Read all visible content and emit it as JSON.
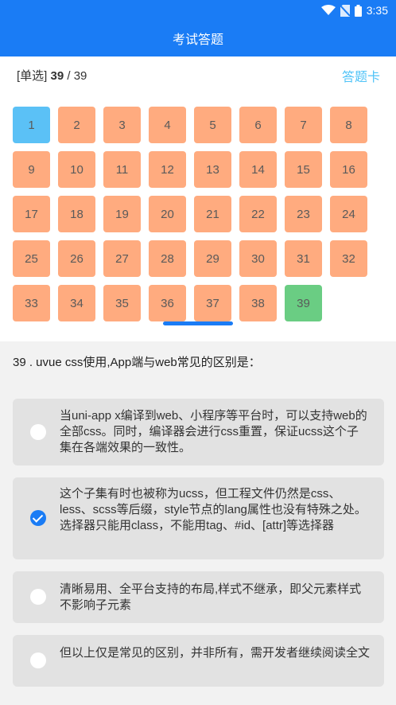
{
  "status_bar": {
    "time": "3:35"
  },
  "header": {
    "title": "考试答题"
  },
  "question_info": {
    "type": "[单选]",
    "current": "39",
    "separator": "/",
    "total": "39"
  },
  "answer_card_link": "答题卡",
  "grid": [
    {
      "num": "1",
      "state": "current"
    },
    {
      "num": "2",
      "state": "unanswered"
    },
    {
      "num": "3",
      "state": "unanswered"
    },
    {
      "num": "4",
      "state": "unanswered"
    },
    {
      "num": "5",
      "state": "unanswered"
    },
    {
      "num": "6",
      "state": "unanswered"
    },
    {
      "num": "7",
      "state": "unanswered"
    },
    {
      "num": "8",
      "state": "unanswered"
    },
    {
      "num": "9",
      "state": "unanswered"
    },
    {
      "num": "10",
      "state": "unanswered"
    },
    {
      "num": "11",
      "state": "unanswered"
    },
    {
      "num": "12",
      "state": "unanswered"
    },
    {
      "num": "13",
      "state": "unanswered"
    },
    {
      "num": "14",
      "state": "unanswered"
    },
    {
      "num": "15",
      "state": "unanswered"
    },
    {
      "num": "16",
      "state": "unanswered"
    },
    {
      "num": "17",
      "state": "unanswered"
    },
    {
      "num": "18",
      "state": "unanswered"
    },
    {
      "num": "19",
      "state": "unanswered"
    },
    {
      "num": "20",
      "state": "unanswered"
    },
    {
      "num": "21",
      "state": "unanswered"
    },
    {
      "num": "22",
      "state": "unanswered"
    },
    {
      "num": "23",
      "state": "unanswered"
    },
    {
      "num": "24",
      "state": "unanswered"
    },
    {
      "num": "25",
      "state": "unanswered"
    },
    {
      "num": "26",
      "state": "unanswered"
    },
    {
      "num": "27",
      "state": "unanswered"
    },
    {
      "num": "28",
      "state": "unanswered"
    },
    {
      "num": "29",
      "state": "unanswered"
    },
    {
      "num": "30",
      "state": "unanswered"
    },
    {
      "num": "31",
      "state": "unanswered"
    },
    {
      "num": "32",
      "state": "unanswered"
    },
    {
      "num": "33",
      "state": "unanswered"
    },
    {
      "num": "34",
      "state": "unanswered"
    },
    {
      "num": "35",
      "state": "unanswered"
    },
    {
      "num": "36",
      "state": "unanswered"
    },
    {
      "num": "37",
      "state": "unanswered"
    },
    {
      "num": "38",
      "state": "unanswered"
    },
    {
      "num": "39",
      "state": "answered"
    }
  ],
  "question": {
    "text": "39 . uvue css使用,App端与web常见的区别是："
  },
  "options": [
    {
      "text": "当uni-app x编译到web、小程序等平台时，可以支持web的全部css。同时，编译器会进行css重置，保证ucss这个子集在各端效果的一致性。",
      "checked": false
    },
    {
      "text": "这个子集有时也被称为ucss，但工程文件仍然是css、less、scss等后缀，style节点的lang属性也没有特殊之处。选择器只能用class，不能用tag、#id、[attr]等选择器",
      "checked": true
    },
    {
      "text": "清晰易用、全平台支持的布局,样式不继承，即父元素样式不影响子元素",
      "checked": false
    },
    {
      "text": "但以上仅是常见的区别，并非所有，需开发者继续阅读全文",
      "checked": false
    }
  ],
  "colors": {
    "primary": "#1a7cf5",
    "unanswered": "#ffab7f",
    "current": "#5bc1f6",
    "answered": "#6acd83",
    "link": "#4fc3f7"
  }
}
